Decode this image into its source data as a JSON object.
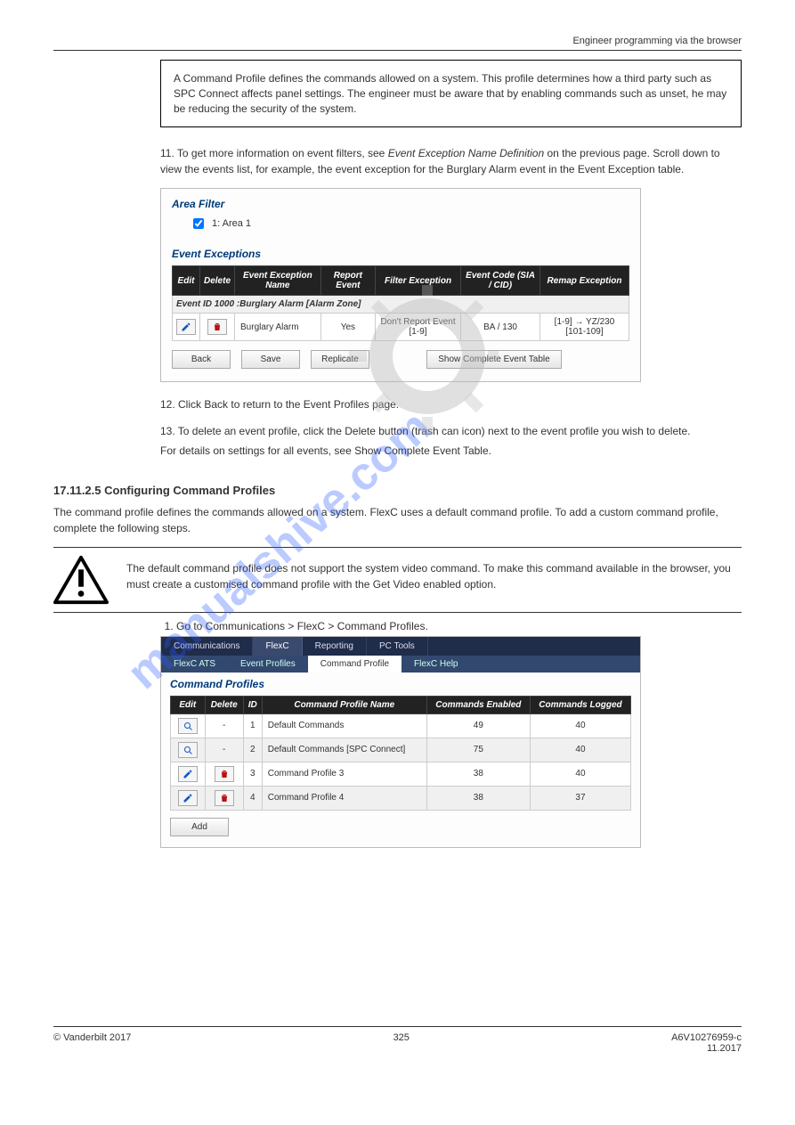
{
  "header": {
    "right": "Engineer programming via the browser"
  },
  "info_box": {
    "text": "A Command Profile defines the commands allowed on a system. This profile determines how a third party such as SPC Connect affects panel settings. The engineer must be aware that by enabling commands such as unset, he may be reducing the security of the system."
  },
  "para1": "11. To get more information on event filters, see ",
  "para1_link": "Event Exception Name Definition",
  "para1_trail": " on the previous page. Scroll down to view the events list, for example, the event exception for the Burglary Alarm event in the Event Exception table.",
  "panel1": {
    "area_filter_title": "Area Filter",
    "area1_label": "1: Area 1",
    "event_exceptions_title": "Event Exceptions",
    "headers": [
      "Edit",
      "Delete",
      "Event Exception Name",
      "Report Event",
      "Filter Exception",
      "Event Code (SIA / CID)",
      "Remap Exception"
    ],
    "group_row": "Event ID 1000 :Burglary Alarm [Alarm Zone]",
    "row": {
      "name": "Burglary Alarm",
      "report": "Yes",
      "filter": "Don't Report Event [1-9]",
      "code": "BA / 130",
      "remap": "[1-9] → YZ/230 [101-109]"
    },
    "buttons": {
      "back": "Back",
      "save": "Save",
      "replicate": "Replicate",
      "show": "Show Complete Event Table"
    }
  },
  "list12": "12. Click Back to return to the Event Profiles page.",
  "list13a": "13. To delete an event profile, click the Delete button (trash can icon) next to the event profile you wish to delete.",
  "list13b": "For details on settings for all events, see Show Complete Event Table.",
  "section_title": "17.11.2.5 Configuring Command Profiles",
  "section_body": "The command profile defines the commands allowed on a system. FlexC uses a default command profile. To add a custom command profile, complete the following steps.",
  "warn": "The default command profile does not support the system video command. To make this command available in the browser, you must create a customised command profile with the Get Video enabled option.",
  "step1": "Go to Communications > FlexC > Command Profiles.",
  "panel2": {
    "tabs_main": [
      "Communications",
      "FlexC",
      "Reporting",
      "PC Tools"
    ],
    "tabs_main_active": 1,
    "tabs_sub": [
      "FlexC ATS",
      "Event Profiles",
      "Command Profile",
      "FlexC Help"
    ],
    "tabs_sub_active": 2,
    "title": "Command Profiles",
    "headers": [
      "Edit",
      "Delete",
      "ID",
      "Command Profile Name",
      "Commands Enabled",
      "Commands Logged"
    ],
    "rows": [
      {
        "edit": "view",
        "delete": "-",
        "id": "1",
        "name": "Default Commands",
        "enabled": "49",
        "logged": "40",
        "alt": false
      },
      {
        "edit": "view",
        "delete": "-",
        "id": "2",
        "name": "Default Commands [SPC Connect]",
        "enabled": "75",
        "logged": "40",
        "alt": true
      },
      {
        "edit": "edit",
        "delete": "trash",
        "id": "3",
        "name": "Command Profile 3",
        "enabled": "38",
        "logged": "40",
        "alt": false
      },
      {
        "edit": "edit",
        "delete": "trash",
        "id": "4",
        "name": "Command Profile 4",
        "enabled": "38",
        "logged": "37",
        "alt": true
      }
    ],
    "add_btn": "Add"
  },
  "footer": {
    "left": "© Vanderbilt 2017",
    "center": "325",
    "right": "A6V10276959-c\n11.2017"
  }
}
